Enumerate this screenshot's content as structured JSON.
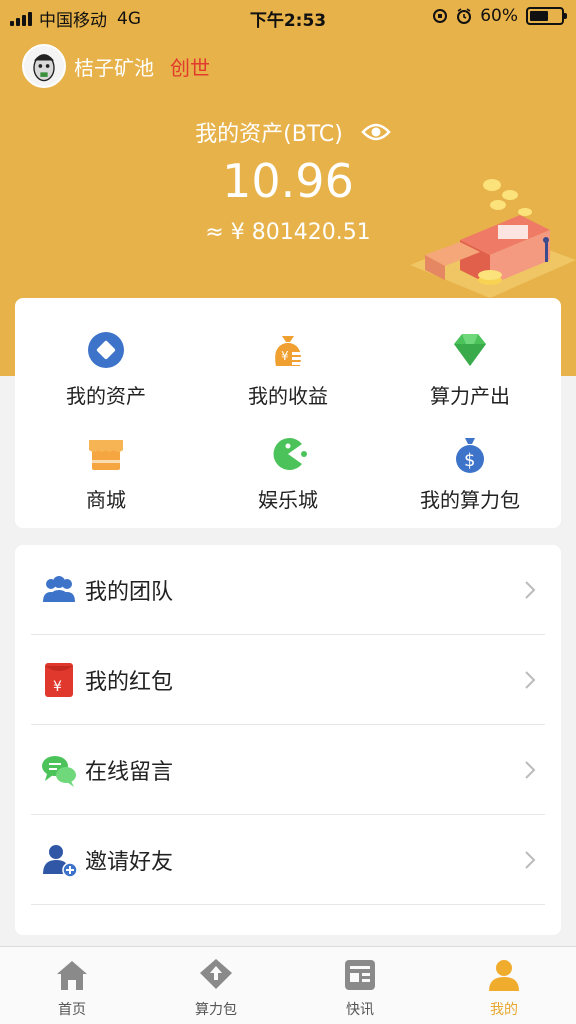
{
  "status_bar": {
    "carrier": "中国移动",
    "network": "4G",
    "time": "下午2:53",
    "battery": "60%",
    "battery_level": 0.6
  },
  "user": {
    "name": "桔子矿池",
    "tag": "创世"
  },
  "assets": {
    "label": "我的资产(BTC)",
    "value": "10.96",
    "cny": "≈ ¥ 801420.51"
  },
  "grid": [
    {
      "label": "我的资产",
      "icon": "diamond-circle-icon"
    },
    {
      "label": "我的收益",
      "icon": "money-bag-icon"
    },
    {
      "label": "算力产出",
      "icon": "gem-icon"
    },
    {
      "label": "商城",
      "icon": "shop-icon"
    },
    {
      "label": "娱乐城",
      "icon": "pacman-icon"
    },
    {
      "label": "我的算力包",
      "icon": "dollar-bag-icon"
    }
  ],
  "list": [
    {
      "label": "我的团队",
      "icon": "team-icon"
    },
    {
      "label": "我的红包",
      "icon": "red-envelope-icon"
    },
    {
      "label": "在线留言",
      "icon": "chat-icon"
    },
    {
      "label": "邀请好友",
      "icon": "invite-user-icon"
    }
  ],
  "tabs": [
    {
      "label": "首页",
      "icon": "home-icon"
    },
    {
      "label": "算力包",
      "icon": "upload-tag-icon"
    },
    {
      "label": "快讯",
      "icon": "news-icon"
    },
    {
      "label": "我的",
      "icon": "person-icon",
      "active": true
    }
  ],
  "colors": {
    "header": "#e7b249",
    "tag": "#e23b2e",
    "active_tab": "#e7a831"
  }
}
